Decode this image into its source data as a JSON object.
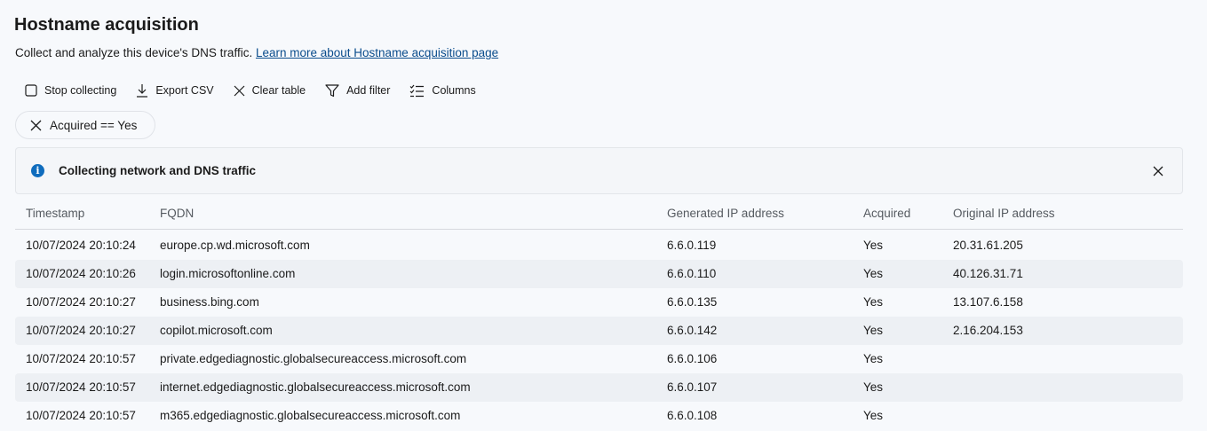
{
  "header": {
    "title": "Hostname acquisition",
    "description": "Collect and analyze this device's DNS traffic.",
    "learn_more_link": "Learn more about Hostname acquisition page"
  },
  "toolbar": {
    "stop_collecting": "Stop collecting",
    "export_csv": "Export CSV",
    "clear_table": "Clear table",
    "add_filter": "Add filter",
    "columns": "Columns"
  },
  "filter_chip": {
    "label": "Acquired == Yes"
  },
  "banner": {
    "message": "Collecting network and DNS traffic",
    "icon": "info-icon"
  },
  "table": {
    "columns": [
      "Timestamp",
      "FQDN",
      "Generated IP address",
      "Acquired",
      "Original IP address"
    ],
    "rows": [
      [
        "10/07/2024 20:10:24",
        "europe.cp.wd.microsoft.com",
        "6.6.0.119",
        "Yes",
        "20.31.61.205"
      ],
      [
        "10/07/2024 20:10:26",
        "login.microsoftonline.com",
        "6.6.0.110",
        "Yes",
        "40.126.31.71"
      ],
      [
        "10/07/2024 20:10:27",
        "business.bing.com",
        "6.6.0.135",
        "Yes",
        "13.107.6.158"
      ],
      [
        "10/07/2024 20:10:27",
        "copilot.microsoft.com",
        "6.6.0.142",
        "Yes",
        "2.16.204.153"
      ],
      [
        "10/07/2024 20:10:57",
        "private.edgediagnostic.globalsecureaccess.microsoft.com",
        "6.6.0.106",
        "Yes",
        ""
      ],
      [
        "10/07/2024 20:10:57",
        "internet.edgediagnostic.globalsecureaccess.microsoft.com",
        "6.6.0.107",
        "Yes",
        ""
      ],
      [
        "10/07/2024 20:10:57",
        "m365.edgediagnostic.globalsecureaccess.microsoft.com",
        "6.6.0.108",
        "Yes",
        ""
      ]
    ]
  },
  "colors": {
    "link": "#0a4c8c",
    "info_accent": "#0f6cbd",
    "alt_row": "#edf0f4",
    "background": "#f7f9fc"
  }
}
